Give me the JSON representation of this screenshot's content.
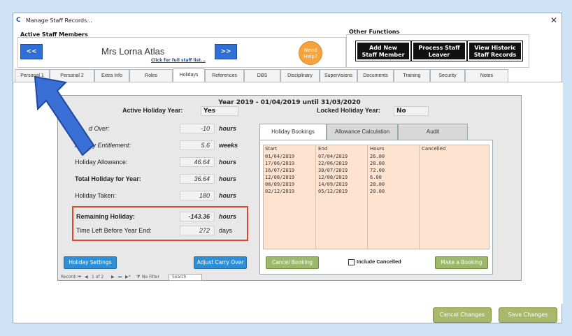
{
  "window": {
    "title": "Manage Staff Records...",
    "app_icon": "C",
    "close_glyph": "✕"
  },
  "header": {
    "active_label": "Active Staff Members",
    "other_label": "Other Functions",
    "prev_label": "<<",
    "next_label": ">>",
    "staff_name": "Mrs Lorna Atlas",
    "full_list_link": "Click for full staff list...",
    "help_line1": "Need",
    "help_line2": "Help?",
    "add_line1": "Add New",
    "add_line2": "Staff Member",
    "leaver_line1": "Process Staff",
    "leaver_line2": "Leaver",
    "historic_line1": "View Historic",
    "historic_line2": "Staff Records"
  },
  "tabs": [
    "Personal 1",
    "Personal 2",
    "Extra Info",
    "Roles",
    "Holidays",
    "References",
    "DBS",
    "Disciplinary",
    "Supervisions",
    "Documents",
    "Training",
    "Security",
    "Notes"
  ],
  "holidays": {
    "year_line": "Year 2019 - 01/04/2019 until 31/03/2020",
    "active_year_label": "Active Holiday Year:",
    "active_year_value": "Yes",
    "locked_year_label": "Locked Holiday Year:",
    "locked_year_value": "No",
    "carried_over_label": "d Over:",
    "carried_over_value": "-10",
    "entitlement_label": "Holiday Entitlement:",
    "entitlement_value": "5.6",
    "allowance_label": "Holiday Allowance:",
    "allowance_value": "46.64",
    "total_label": "Total Holiday for Year:",
    "total_value": "36.64",
    "taken_label": "Holiday Taken:",
    "taken_value": "180",
    "remaining_label": "Remaining Holiday:",
    "remaining_value": "-143.36",
    "timeleft_label": "Time Left Before Year End:",
    "timeleft_value": "272",
    "unit_hours": "hours",
    "unit_weeks": "weeks",
    "unit_days": "days",
    "settings_button": "Holiday Settings",
    "adjust_button": "Adjust Carry Over"
  },
  "subtabs": [
    "Holiday Bookings",
    "Allowance Calculation",
    "Audit"
  ],
  "bookings": {
    "headers": [
      "Start",
      "End",
      "Hours",
      "Cancelled"
    ],
    "rows": [
      [
        "01/04/2019",
        "07/04/2019",
        "26.00"
      ],
      [
        "17/06/2019",
        "22/06/2019",
        "28.00"
      ],
      [
        "16/07/2019",
        "30/07/2019",
        "72.00"
      ],
      [
        "12/08/2019",
        "12/08/2019",
        "6.00"
      ],
      [
        "08/09/2019",
        "14/09/2019",
        "28.00"
      ],
      [
        "02/12/2019",
        "05/12/2019",
        "20.00"
      ]
    ],
    "cancel_button": "Cancel Booking",
    "include_cancelled": "Include Cancelled",
    "make_button": "Make a Booking"
  },
  "record_nav": {
    "record_label": "Record: ",
    "first": "⏮",
    "prev": "◀",
    "position": "1 of 2",
    "next": "▶",
    "last": "⏭",
    "new": "▶*",
    "filter_icon": "⧩",
    "no_filter": "No Filter",
    "search": "Search"
  },
  "footer": {
    "cancel_changes": "Cancel Changes",
    "save_changes": "Save Changes"
  },
  "colors": {
    "accent_blue": "#2f6fd6",
    "help_orange": "#f7a23a",
    "green_button": "#9cb86a",
    "highlight_red": "#d9472f"
  }
}
